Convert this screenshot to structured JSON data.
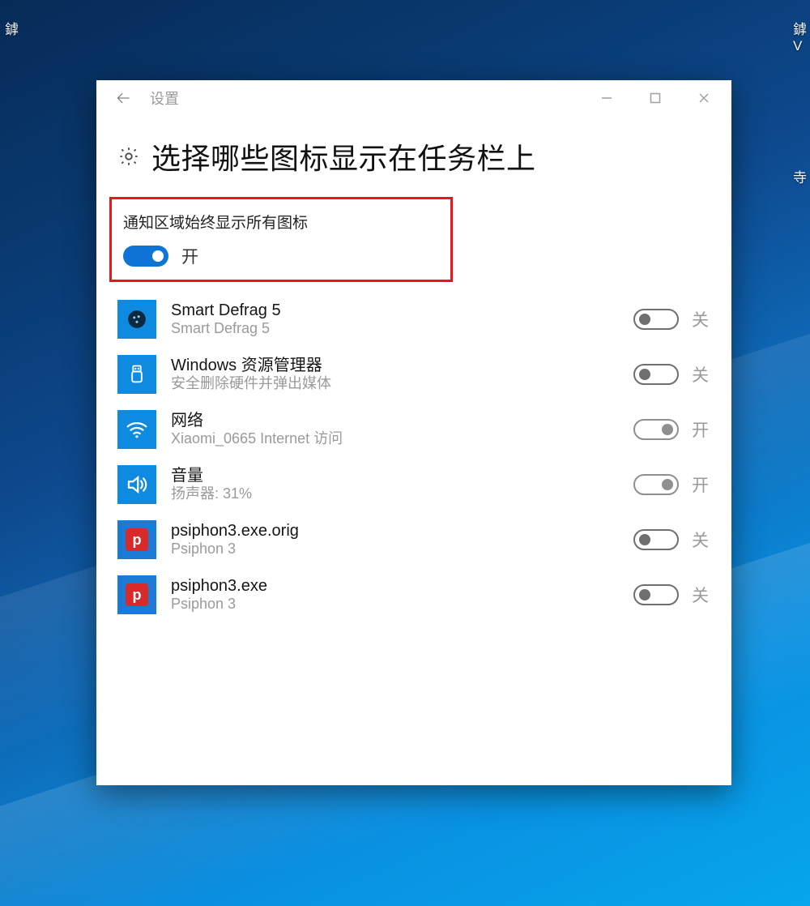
{
  "desktop": {
    "edge_left": "鎼",
    "edge_right_line1": "鎼",
    "edge_right_line2": "V",
    "edge_right2": "寺"
  },
  "window": {
    "title": "设置",
    "heading": "选择哪些图标显示在任务栏上"
  },
  "master": {
    "label": "通知区域始终显示所有图标",
    "state": "开",
    "on": true
  },
  "state_labels": {
    "on": "开",
    "off": "关"
  },
  "items": [
    {
      "icon": "defrag",
      "title": "Smart Defrag 5",
      "sub": "Smart Defrag 5",
      "state": "关",
      "on": false
    },
    {
      "icon": "usb",
      "title": "Windows 资源管理器",
      "sub": "安全删除硬件并弹出媒体",
      "state": "关",
      "on": false
    },
    {
      "icon": "wifi",
      "title": "网络",
      "sub": "Xiaomi_0665 Internet 访问",
      "state": "开",
      "on": true
    },
    {
      "icon": "volume",
      "title": "音量",
      "sub": "扬声器: 31%",
      "state": "开",
      "on": true
    },
    {
      "icon": "psiphon",
      "title": "psiphon3.exe.orig",
      "sub": "Psiphon 3",
      "state": "关",
      "on": false
    },
    {
      "icon": "psiphon",
      "title": "psiphon3.exe",
      "sub": "Psiphon 3",
      "state": "关",
      "on": false
    }
  ]
}
